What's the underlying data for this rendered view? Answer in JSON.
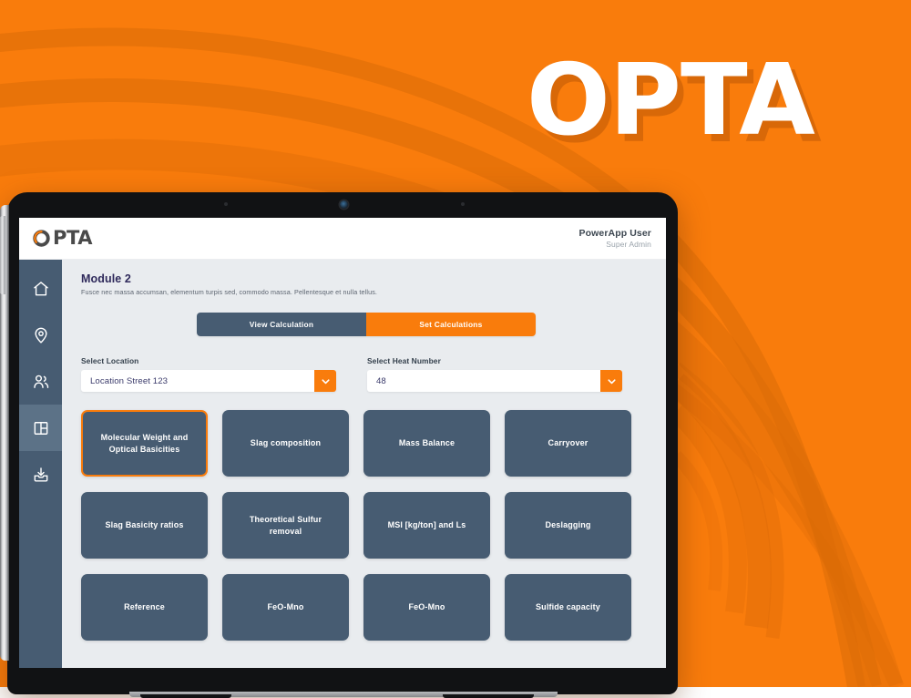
{
  "hero": {
    "wordmark": "OPTA"
  },
  "app": {
    "brand": {
      "text": "PTA",
      "mark_icon": "opta-ring-o-icon"
    },
    "user": {
      "name": "PowerApp User",
      "role": "Super Admin"
    },
    "sidebar": {
      "items": [
        {
          "icon": "home-icon",
          "name": "sidebar-item-home",
          "active": false
        },
        {
          "icon": "location-pin-icon",
          "name": "sidebar-item-location",
          "active": false
        },
        {
          "icon": "users-icon",
          "name": "sidebar-item-users",
          "active": false
        },
        {
          "icon": "dashboard-layout-icon",
          "name": "sidebar-item-dashboard",
          "active": true
        },
        {
          "icon": "download-inbox-icon",
          "name": "sidebar-item-downloads",
          "active": false
        }
      ]
    },
    "page": {
      "title": "Module 2",
      "subtitle": "Fusce nec massa accumsan, elementum turpis sed, commodo massa. Pellentesque et nulla tellus."
    },
    "tabs": [
      {
        "label": "View Calculation",
        "active": false
      },
      {
        "label": "Set Calculations",
        "active": true
      }
    ],
    "filters": [
      {
        "label": "Select Location",
        "value": "Location Street 123",
        "caret_icon": "chevron-down-icon"
      },
      {
        "label": "Select Heat Number",
        "value": "48",
        "caret_icon": "chevron-down-icon"
      }
    ],
    "cards": [
      {
        "label": "Molecular Weight and Optical Basicities",
        "selected": true
      },
      {
        "label": "Slag composition",
        "selected": false
      },
      {
        "label": "Mass Balance",
        "selected": false
      },
      {
        "label": "Carryover",
        "selected": false
      },
      {
        "label": "Slag Basicity ratios",
        "selected": false
      },
      {
        "label": "Theoretical Sulfur removal",
        "selected": false
      },
      {
        "label": "MSI [kg/ton] and Ls",
        "selected": false
      },
      {
        "label": "Deslagging",
        "selected": false
      },
      {
        "label": "Reference",
        "selected": false
      },
      {
        "label": "FeO-Mno",
        "selected": false
      },
      {
        "label": "FeO-Mno",
        "selected": false
      },
      {
        "label": "Sulfide capacity",
        "selected": false
      }
    ]
  },
  "colors": {
    "brand_orange": "#F97C0C",
    "slate": "#475C72",
    "slate_active": "#5C7287",
    "page_bg": "#E9ECEF",
    "title_navy": "#2F2A5B",
    "white": "#FFFFFF"
  }
}
